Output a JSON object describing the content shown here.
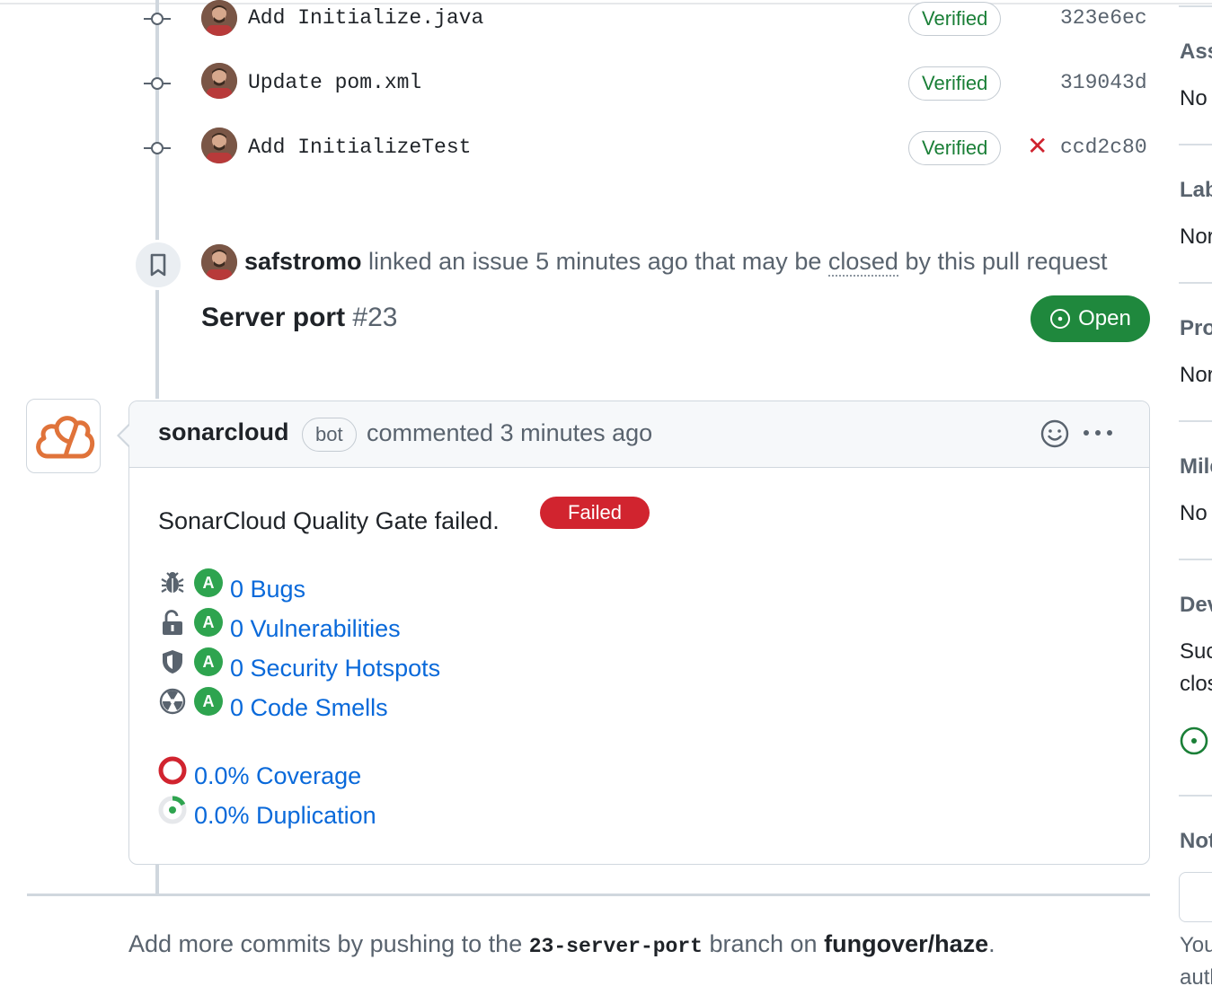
{
  "commits": [
    {
      "message": "Add Initialize.java",
      "badge": "Verified",
      "sha": "323e6ec",
      "failed": false
    },
    {
      "message": "Update pom.xml",
      "badge": "Verified",
      "sha": "319043d",
      "failed": false
    },
    {
      "message": "Add InitializeTest",
      "badge": "Verified",
      "sha": "ccd2c80",
      "failed": true
    }
  ],
  "link_event": {
    "user": "safstromo",
    "text_before": "linked an issue 5 minutes ago that may be",
    "closed_word": "closed",
    "text_after": "by this pull request"
  },
  "issue": {
    "title": "Server port",
    "number": "#23",
    "state": "Open"
  },
  "comment": {
    "author": "sonarcloud",
    "badge": "bot",
    "meta": "commented 3 minutes ago",
    "gate_text": "SonarCloud Quality Gate failed.",
    "gate_status": "Failed",
    "rating_letter": "A",
    "metrics": [
      {
        "icon": "bug-icon",
        "label": "0 Bugs"
      },
      {
        "icon": "unlock-icon",
        "label": "0 Vulnerabilities"
      },
      {
        "icon": "shield-icon",
        "label": "0 Security Hotspots"
      },
      {
        "icon": "radiation-icon",
        "label": "0 Code Smells"
      }
    ],
    "coverage": "0.0% Coverage",
    "duplication": "0.0% Duplication"
  },
  "footer": {
    "prefix": "Add more commits by pushing to the",
    "branch": "23-server-port",
    "middle": "branch on",
    "repo": "fungover/haze",
    "suffix": "."
  },
  "sidebar": {
    "sections": [
      {
        "heading": "Ass",
        "value": "No"
      },
      {
        "heading": "Lab",
        "value": "Nor"
      },
      {
        "heading": "Pro",
        "value": "Nor"
      },
      {
        "heading": "Mile",
        "value": "No"
      },
      {
        "heading": "Dev",
        "value": "Suc",
        "value2": "clos"
      },
      {
        "heading": "Not",
        "value": "You",
        "value2": "autl"
      }
    ]
  },
  "colors": {
    "accent": "#0969da",
    "success": "#1f883d",
    "danger": "#d1242f",
    "rating": "#2ea44f",
    "sonar": "#e0733a"
  }
}
